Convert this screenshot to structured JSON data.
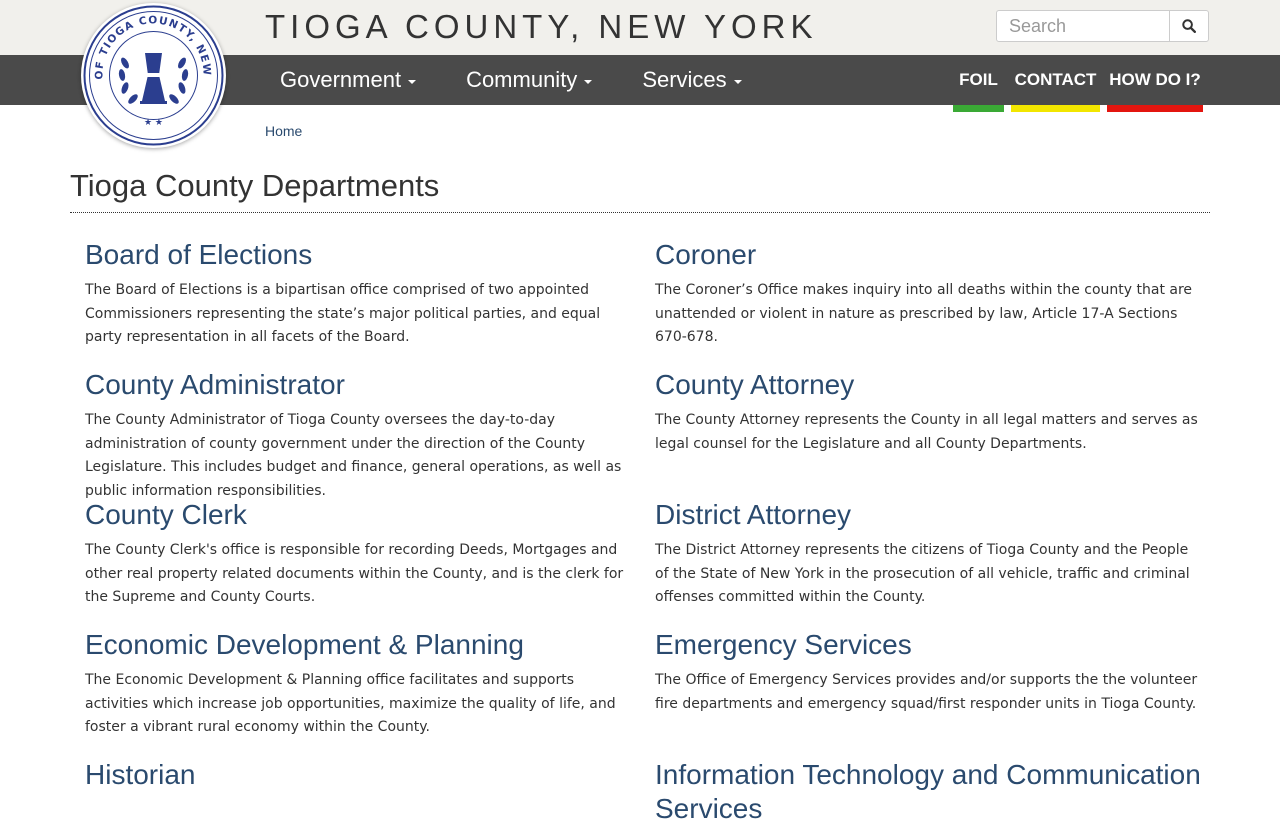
{
  "header": {
    "site_title": "TIOGA COUNTY, NEW YORK",
    "seal_text": "SEAL OF TIOGA COUNTY, NEW YORK",
    "search": {
      "placeholder": "Search",
      "icon": "search-icon"
    }
  },
  "nav": {
    "main": [
      {
        "label": "Government"
      },
      {
        "label": "Community"
      },
      {
        "label": "Services"
      }
    ],
    "quick": [
      {
        "label": "FOIL",
        "accent": "#3aa935"
      },
      {
        "label": "CONTACT",
        "accent": "#f2e600"
      },
      {
        "label": "HOW DO I?",
        "accent": "#e3150f"
      }
    ]
  },
  "breadcrumb": {
    "home": "Home"
  },
  "page": {
    "title": "Tioga County Departments"
  },
  "departments": [
    {
      "name": "Board of Elections",
      "desc": "The Board of Elections is a bipartisan office comprised of two appointed Commissioners representing the state’s major political parties, and equal party representation in all facets of the Board."
    },
    {
      "name": "Coroner",
      "desc": "The Coroner’s Office makes inquiry into all deaths within the county that are unattended or violent in nature as prescribed by law, Article 17-A Sections 670-678."
    },
    {
      "name": "County Administrator",
      "desc": "The County Administrator of Tioga County oversees the day-to-day administration of county government under the direction of the County Legislature. This includes budget and finance, general operations, as well as public information responsibilities."
    },
    {
      "name": "County Attorney",
      "desc": "The County Attorney represents the County in all legal matters and serves as legal counsel for the Legislature and all County Departments."
    },
    {
      "name": "County Clerk",
      "desc": "The County Clerk's office is responsible for recording Deeds, Mortgages and other real property related documents within the County, and is the clerk for the Supreme and County Courts."
    },
    {
      "name": "District Attorney",
      "desc": "The District Attorney represents the citizens of Tioga County and the People of the State of New York in the prosecution of all vehicle, traffic and criminal offenses committed within the County."
    },
    {
      "name": "Economic Development & Planning",
      "desc": "The Economic Development & Planning office facilitates and supports activities which increase job opportunities, maximize the quality of life, and foster a vibrant rural economy within the County."
    },
    {
      "name": "Emergency Services",
      "desc": "The Office of Emergency Services provides and/or supports the the volunteer fire departments and emergency squad/first responder units in Tioga County."
    },
    {
      "name": "Historian",
      "desc": ""
    },
    {
      "name": "Information Technology and Communication Services",
      "desc": ""
    }
  ],
  "colors": {
    "topbar": "#f1f0ec",
    "navbar": "#4a4a4a",
    "link": "#2a4a6e",
    "seal": "#2b3e8f"
  }
}
